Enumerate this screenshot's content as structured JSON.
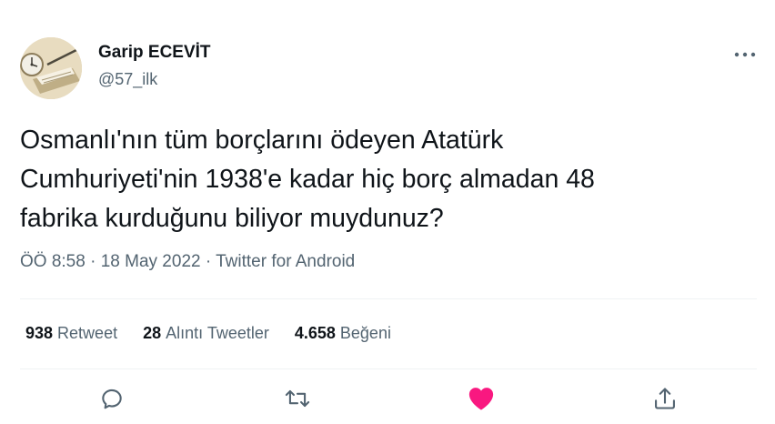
{
  "author": {
    "name": "Garip ECEVİT",
    "handle": "@57_ilk"
  },
  "tweet": {
    "text_lines": [
      "Osmanlı'nın tüm borçlarını ödeyen Atatürk",
      "Cumhuriyeti'nin 1938'e kadar hiç borç almadan 48",
      "fabrika kurduğunu biliyor muydunuz?"
    ],
    "time": "ÖÖ 8:58",
    "date": "18 May 2022",
    "separator": "·",
    "source": "Twitter for Android"
  },
  "stats": {
    "retweets": {
      "count": "938",
      "label": "Retweet"
    },
    "quotes": {
      "count": "28",
      "label": "Alıntı Tweetler"
    },
    "likes": {
      "count": "4.658",
      "label": "Beğeni"
    }
  },
  "icons": {
    "more": "more-horizontal-icon",
    "reply": "reply-icon",
    "retweet": "retweet-icon",
    "like": "heart-icon",
    "share": "share-icon"
  },
  "colors": {
    "text_primary": "#0f1419",
    "text_secondary": "#536471",
    "like_active": "#f91880",
    "divider": "#eff3f4"
  }
}
